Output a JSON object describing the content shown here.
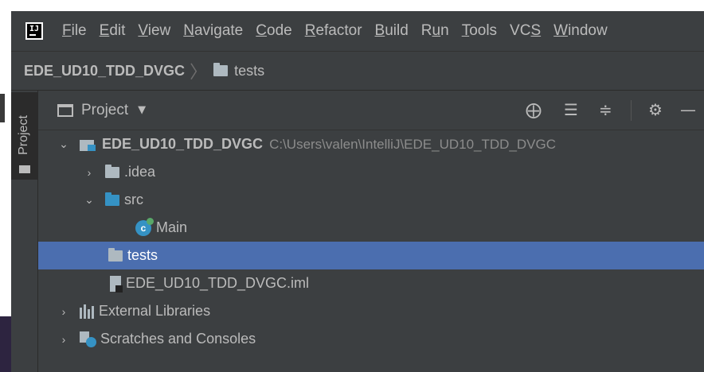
{
  "app": {
    "logo_text": "IJ"
  },
  "menu": [
    {
      "label": "File",
      "mnemonic_index": 0
    },
    {
      "label": "Edit",
      "mnemonic_index": 0
    },
    {
      "label": "View",
      "mnemonic_index": 0
    },
    {
      "label": "Navigate",
      "mnemonic_index": 0
    },
    {
      "label": "Code",
      "mnemonic_index": 0
    },
    {
      "label": "Refactor",
      "mnemonic_index": 0
    },
    {
      "label": "Build",
      "mnemonic_index": 0
    },
    {
      "label": "Run",
      "mnemonic_index": 1
    },
    {
      "label": "Tools",
      "mnemonic_index": 0
    },
    {
      "label": "VCS",
      "mnemonic_index": 2
    },
    {
      "label": "Window",
      "mnemonic_index": 0
    }
  ],
  "breadcrumb": {
    "root": "EDE_UD10_TDD_DVGC",
    "separator": "〉",
    "folder": "tests"
  },
  "tool_strip": {
    "project_tab": "Project"
  },
  "panel": {
    "title": "Project",
    "dropdown": "▼"
  },
  "tree": [
    {
      "label": "EDE_UD10_TDD_DVGC",
      "path": "C:\\Users\\valen\\IntelliJ\\EDE_UD10_TDD_DVGC",
      "arrow": "⌄",
      "icon": "module-icon"
    },
    {
      "label": ".idea",
      "arrow": "›",
      "icon": "folder-icon"
    },
    {
      "label": "src",
      "arrow": "⌄",
      "icon": "source-folder-icon"
    },
    {
      "label": "Main",
      "arrow": "",
      "icon": "java-class-icon"
    },
    {
      "label": "tests",
      "arrow": "",
      "icon": "folder-icon",
      "selected": true
    },
    {
      "label": "EDE_UD10_TDD_DVGC.iml",
      "arrow": "",
      "icon": "iml-file-icon"
    },
    {
      "label": "External Libraries",
      "arrow": "›",
      "icon": "libraries-icon"
    },
    {
      "label": "Scratches and Consoles",
      "arrow": "›",
      "icon": "scratches-icon"
    }
  ],
  "colors": {
    "background": "#3c3f41",
    "selection": "#4b6eaf",
    "accent_blue": "#3592c4",
    "text": "#bbbbbb"
  }
}
